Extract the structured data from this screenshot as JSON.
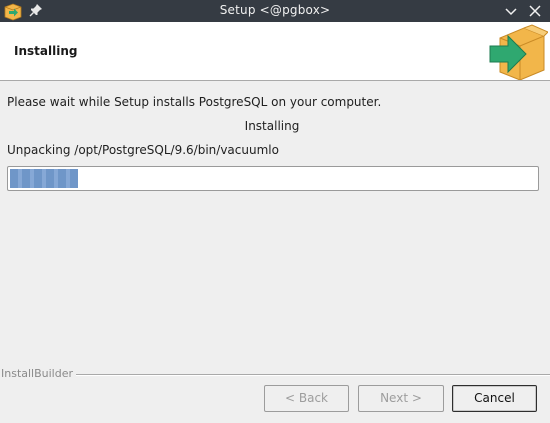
{
  "window": {
    "title": "Setup <@pgbox>",
    "icons": {
      "app": "installer-box-icon",
      "pin": "pin-icon",
      "minimize": "chevron-down-icon",
      "close": "close-icon"
    }
  },
  "header": {
    "title": "Installing",
    "logo_icon": "installer-box-arrow-icon"
  },
  "body": {
    "message": "Please wait while Setup installs PostgreSQL on your computer.",
    "status": "Installing",
    "current_file": "Unpacking /opt/PostgreSQL/9.6/bin/vacuumlo",
    "progress_fraction": 0.13
  },
  "footer": {
    "brand": "InstallBuilder",
    "back_label": "< Back",
    "next_label": "Next >",
    "cancel_label": "Cancel"
  },
  "colors": {
    "titlebar": "#353b43",
    "progress_fill": "#6f96c8",
    "logo_box": "#f2b64a",
    "logo_arrow": "#2fa870"
  }
}
